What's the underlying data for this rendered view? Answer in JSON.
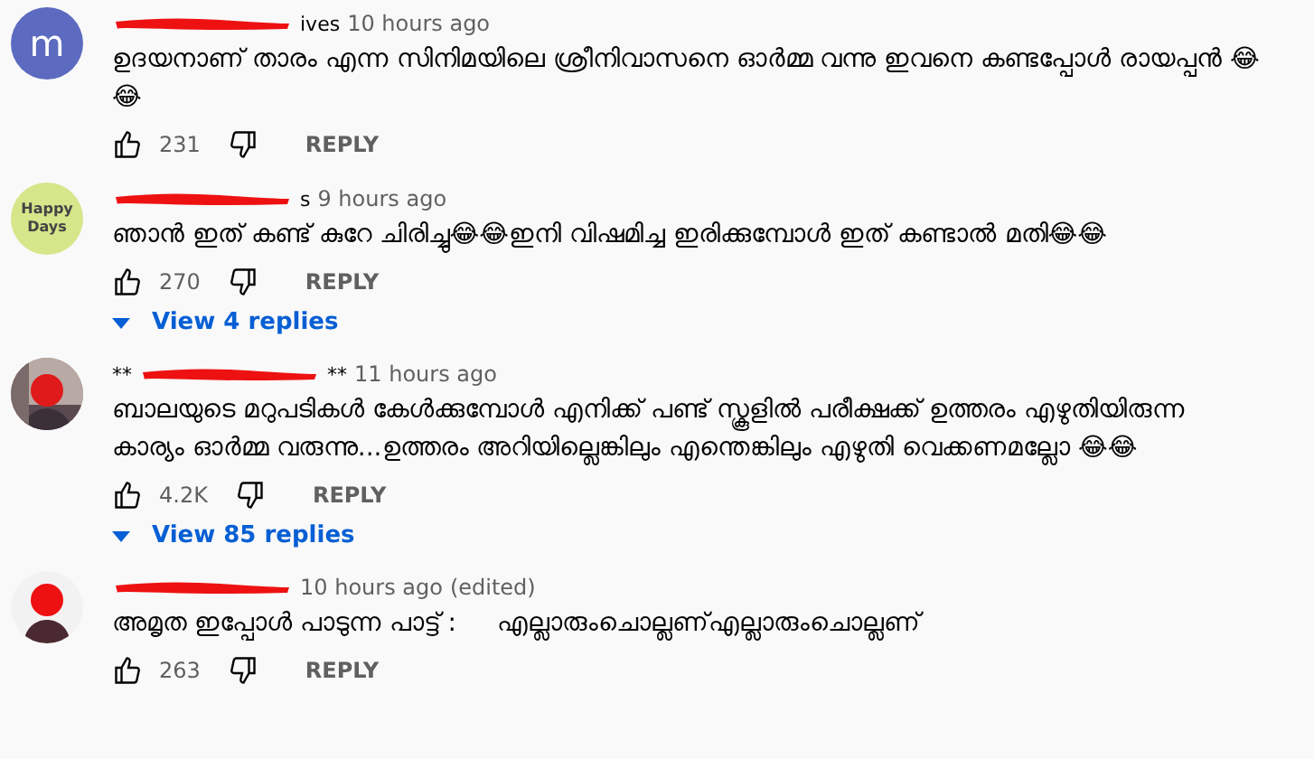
{
  "comments": [
    {
      "avatar": {
        "kind": "letter",
        "text": "m"
      },
      "name_after": "ives",
      "time": "10 hours ago",
      "text": "ഉദയനാണ് താരം എന്ന സിനിമയിലെ ശ്രീനിവാസനെ ഓർമ്മ വന്നു ഇവനെ കണ്ടപ്പോൾ രായപ്പൻ 😂 😂",
      "likes": "231",
      "reply": "REPLY"
    },
    {
      "avatar": {
        "kind": "logo",
        "text": "Happy Days"
      },
      "name_after": "s",
      "time": "9 hours ago",
      "text": "ഞാൻ ഇത് കണ്ട് കുറേ ചിരിച്ചു😂😂ഇനി വിഷമിച്ച ഇരിക്കുമ്പോൾ ഇത് കണ്ടാൽ മതി😂😂",
      "likes": "270",
      "reply": "REPLY",
      "replies": "View 4 replies"
    },
    {
      "name_before": "**",
      "name_after": "**",
      "time": "11 hours ago",
      "text": "ബാലയുടെ മറുപടികൾ കേൾക്കുമ്പോൾ എനിക്ക് പണ്ട് സ്കൂളിൽ പരീക്ഷക്ക് ഉത്തരം എഴുതിയിരുന്ന കാര്യം ഓർമ്മ വരുന്നു...ഉത്തരം അറിയില്ലെങ്കിലും എന്തെങ്കിലും എഴുതി വെക്കണമല്ലോ 😂😂",
      "likes": "4.2K",
      "reply": "REPLY",
      "replies": "View 85 replies"
    },
    {
      "avatar": {
        "kind": "silhouette"
      },
      "time": "10 hours ago",
      "edited": "(edited)",
      "text": "അമൃത ഇപ്പോൾ പാടുന്ന പാട്ട് :     എല്ലാരുംചൊല്ലണ്എല്ലാരുംചൊല്ലണ്",
      "likes": "263",
      "reply": "REPLY"
    }
  ]
}
